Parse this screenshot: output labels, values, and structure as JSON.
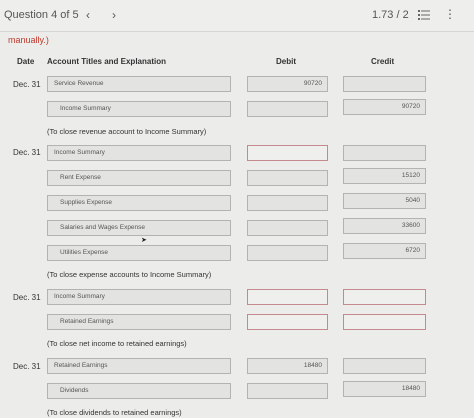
{
  "header": {
    "question": "Question 4 of 5",
    "prev": "‹",
    "next": "›",
    "score": "1.73 / 2",
    "list_icon": "list-icon",
    "menu_icon": "kebab-icon"
  },
  "note": "manually.)",
  "columns": {
    "date": "Date",
    "account": "Account Titles and Explanation",
    "debit": "Debit",
    "credit": "Credit"
  },
  "entries": [
    {
      "date": "Dec. 31",
      "lines": [
        {
          "account": "Service Revenue",
          "debit": "90720",
          "credit": ""
        },
        {
          "account": "Income Summary",
          "debit": "",
          "credit": "90720"
        }
      ],
      "caption": "(To close revenue account to Income Summary)"
    },
    {
      "date": "Dec. 31",
      "lines": [
        {
          "account": "Income Summary",
          "debit": "",
          "credit": ""
        },
        {
          "account": "Rent Expense",
          "debit": "",
          "credit": "15120"
        },
        {
          "account": "Supplies Expense",
          "debit": "",
          "credit": "5040"
        },
        {
          "account": "Salaries and Wages Expense",
          "debit": "",
          "credit": "33600"
        },
        {
          "account": "Utilities Expense",
          "debit": "",
          "credit": "6720"
        }
      ],
      "caption": "(To close expense accounts to Income Summary)"
    },
    {
      "date": "Dec. 31",
      "lines": [
        {
          "account": "Income Summary",
          "debit": "",
          "credit": ""
        },
        {
          "account": "Retained Earnings",
          "debit": "",
          "credit": ""
        }
      ],
      "caption": "(To close net income to retained earnings)"
    },
    {
      "date": "Dec. 31",
      "lines": [
        {
          "account": "Retained Earnings",
          "debit": "18480",
          "credit": ""
        },
        {
          "account": "Dividends",
          "debit": "",
          "credit": "18480"
        }
      ],
      "caption": "(To close dividends to retained earnings)"
    }
  ],
  "colors": {
    "error_border": "#c4898f",
    "note_red": "#c0392b"
  }
}
